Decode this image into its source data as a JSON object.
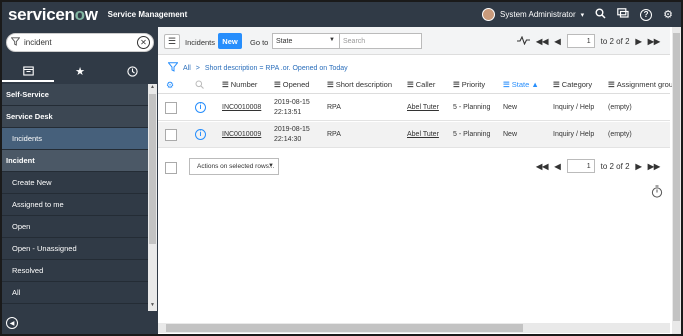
{
  "header": {
    "logo_prefix": "servicen",
    "logo_o": "o",
    "logo_suffix": "w",
    "app_name": "Service Management",
    "user_name": "System Administrator",
    "icons": [
      "search-icon",
      "chat-icon",
      "help-icon",
      "settings-icon"
    ]
  },
  "sidebar": {
    "filter_value": "incident",
    "tabs": [
      "all-applications",
      "favorites",
      "history"
    ],
    "items": [
      {
        "label": "Self-Service",
        "kind": "module-header"
      },
      {
        "label": "Service Desk",
        "kind": "module-header"
      },
      {
        "label": "Incidents",
        "kind": "active"
      },
      {
        "label": "Incident",
        "kind": "module-header2"
      },
      {
        "label": "Create New",
        "kind": "sub"
      },
      {
        "label": "Assigned to me",
        "kind": "sub"
      },
      {
        "label": "Open",
        "kind": "sub"
      },
      {
        "label": "Open - Unassigned",
        "kind": "sub"
      },
      {
        "label": "Resolved",
        "kind": "sub"
      },
      {
        "label": "All",
        "kind": "sub"
      }
    ]
  },
  "toolbar": {
    "title": "Incidents",
    "new_label": "New",
    "goto_label": "Go to",
    "goto_value": "State",
    "search_placeholder": "Search",
    "page_value": "1",
    "page_total": "to 2 of 2"
  },
  "breadcrumb": {
    "all": "All",
    "sep": ">",
    "condition": "Short description = RPA .or. Opened on Today"
  },
  "columns": [
    "Number",
    "Opened",
    "Short description",
    "Caller",
    "Priority",
    "State",
    "Category",
    "Assignment group"
  ],
  "rows": [
    {
      "number": "INC0010008",
      "opened_date": "2019-08-15",
      "opened_time": "22:13:51",
      "short_description": "RPA",
      "caller": "Abel Tuter",
      "priority": "5 - Planning",
      "state": "New",
      "category": "Inquiry / Help",
      "assignment_group": "(empty)"
    },
    {
      "number": "INC0010009",
      "opened_date": "2019-08-15",
      "opened_time": "22:14:30",
      "short_description": "RPA",
      "caller": "Abel Tuter",
      "priority": "5 - Planning",
      "state": "New",
      "category": "Inquiry / Help",
      "assignment_group": "(empty)"
    }
  ],
  "actions": {
    "select_label": "Actions on selected rows...",
    "page_value": "1",
    "page_total": "to 2 of 2"
  },
  "colors": {
    "header_bg": "#303a46",
    "accent": "#278efc",
    "active_nav": "#46607b"
  }
}
